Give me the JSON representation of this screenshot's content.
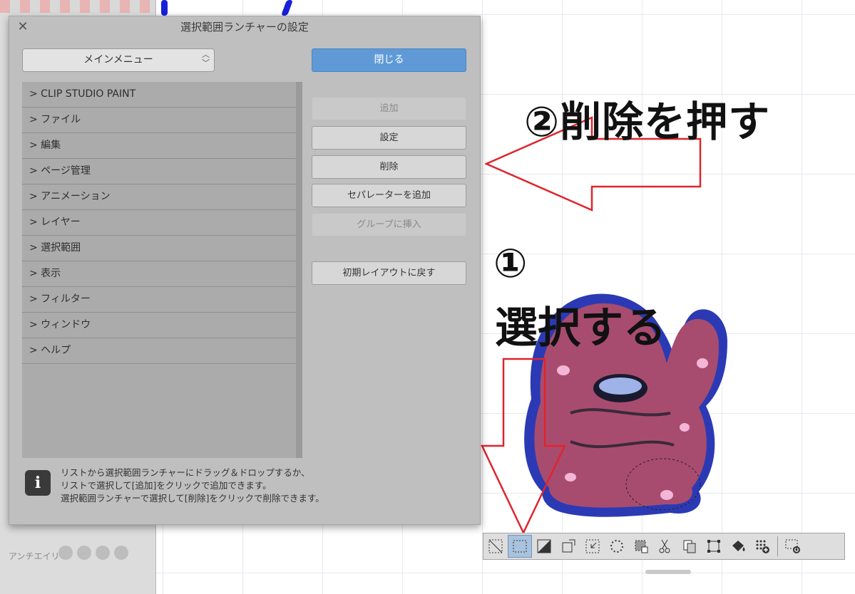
{
  "dialog": {
    "title": "選択範囲ランチャーの設定",
    "close_glyph": "✕",
    "menu_select": "メインメニュー",
    "buttons": {
      "close": "閉じる",
      "add": "追加",
      "settings": "設定",
      "delete": "削除",
      "add_separator": "セパレーターを追加",
      "insert_group": "グループに挿入",
      "reset_layout": "初期レイアウトに戻す"
    },
    "tree_items": [
      "> CLIP STUDIO PAINT",
      "> ファイル",
      "> 編集",
      "> ページ管理",
      "> アニメーション",
      "> レイヤー",
      "> 選択範囲",
      "> 表示",
      "> フィルター",
      "> ウィンドウ",
      "> ヘルプ"
    ],
    "info_icon": "i",
    "info_lines": [
      "リストから選択範囲ランチャーにドラッグ＆ドロップするか、",
      "リストで選択して[追加]をクリックで追加できます。",
      "選択範囲ランチャーで選択して[削除]をクリックで削除できます。"
    ]
  },
  "left_panel": {
    "antialias_label": "アンチエイリ"
  },
  "annotations": {
    "step2": "②削除を押す",
    "step1_num": "①",
    "step1_text": "選択する",
    "arrow_color": "#e0242c"
  },
  "toolbar": {
    "icons": [
      "deselect-icon",
      "select-all-icon",
      "invert-selection-icon",
      "expand-selection-icon",
      "shrink-selection-icon",
      "feather-selection-icon",
      "selection-to-layer-icon",
      "cut-paste-icon",
      "copy-paste-icon",
      "transform-icon",
      "fill-icon",
      "new-tone-icon"
    ],
    "settings_icon": "launcher-settings-icon",
    "active_index": 1
  },
  "colors": {
    "primary_button": "#5f9ad7",
    "dialog_bg": "#bfbfbf",
    "annotation_red": "#e0242c"
  }
}
